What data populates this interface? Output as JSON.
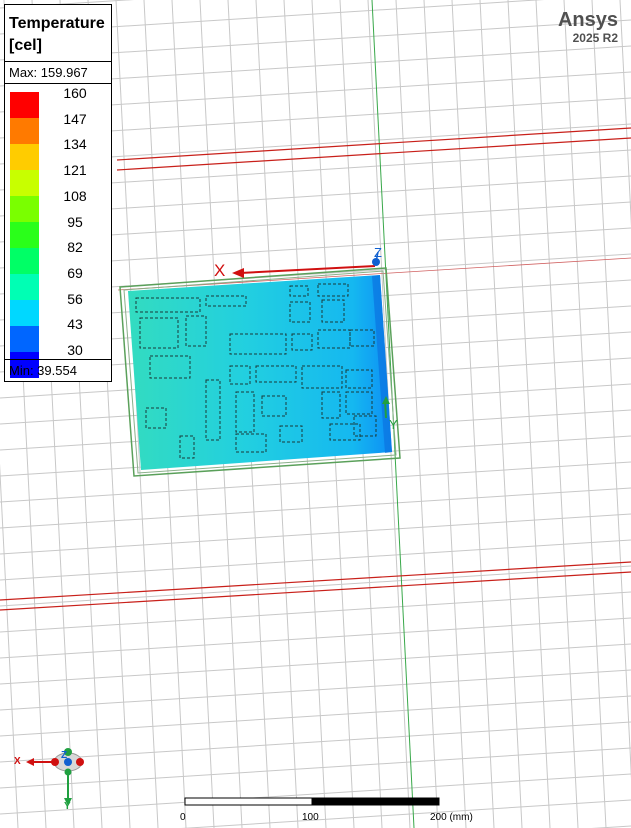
{
  "brand": {
    "name": "Ansys",
    "version": "2025 R2"
  },
  "legend": {
    "title_line1": "Temperature",
    "title_line2": "[cel]",
    "max_label": "Max: 159.967",
    "min_label": "Min:  39.554",
    "levels": [
      "160",
      "147",
      "134",
      "121",
      "108",
      "95",
      "82",
      "69",
      "56",
      "43",
      "30"
    ],
    "colors": [
      "#ff0000",
      "#ff7a00",
      "#ffcc00",
      "#c8ff00",
      "#7aff00",
      "#2aff1a",
      "#00ff66",
      "#00ffb4",
      "#00d8ff",
      "#0066ff",
      "#0000ff"
    ]
  },
  "axes": {
    "x_label": "X",
    "y_label": "Y",
    "z_label": "Z"
  },
  "triad": {
    "x_label": "X",
    "y_label": "Y",
    "z_label": "Z"
  },
  "scale_bar": {
    "labels": [
      "0",
      "100",
      "200 (mm)"
    ]
  }
}
